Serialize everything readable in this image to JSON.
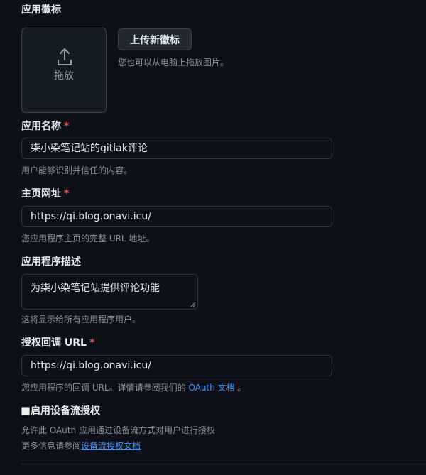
{
  "logo": {
    "label": "应用徽标",
    "drop_text": "拖放",
    "upload_button": "上传新徽标",
    "hint": "您也可以从电脑上拖放图片。",
    "icon": "upload-icon"
  },
  "app_name": {
    "label": "应用名称",
    "required_mark": "*",
    "value": "柒小染笔记站的gitlak评论",
    "hint": "用户能够识别并信任的内容。"
  },
  "homepage": {
    "label": "主页网址",
    "required_mark": "*",
    "value": "https://qi.blog.onavi.icu/",
    "hint": "您应用程序主页的完整 URL 地址。"
  },
  "description": {
    "label": "应用程序描述",
    "value": "为柒小染笔记站提供评论功能",
    "hint": "这将显示给所有应用程序用户。"
  },
  "callback": {
    "label": "授权回调 URL",
    "required_mark": "*",
    "value": "https://qi.blog.onavi.icu/",
    "hint_prefix": "您应用程序的回调 URL。详情请参阅我们的 ",
    "hint_link": "OAuth 文档",
    "hint_suffix": " 。"
  },
  "device_flow": {
    "checked": false,
    "label": "启用设备流授权",
    "description": "允许此 OAuth 应用通过设备流方式对用户进行授权",
    "more_prefix": "更多信息请参阅",
    "more_link": "设备流授权文档"
  },
  "colors": {
    "background": "#0d1117",
    "text": "#e6edf3",
    "muted": "#8b949e",
    "link": "#4493f8",
    "required": "#f85149",
    "border": "#30363d"
  }
}
